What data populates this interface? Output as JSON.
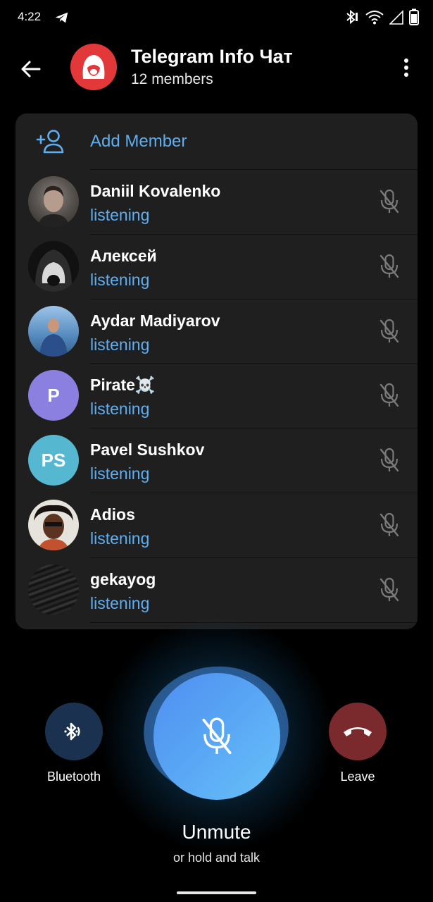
{
  "status_bar": {
    "time": "4:22",
    "icons": [
      "telegram-icon",
      "bluetooth-icon",
      "vibrate-icon",
      "wifi-icon",
      "signal-icon",
      "battery-icon"
    ]
  },
  "header": {
    "title": "Telegram Info Чат",
    "subtitle": "12 members",
    "back_icon": "arrow-left-icon",
    "menu_icon": "more-vertical-icon"
  },
  "participants": {
    "add_member_label": "Add Member",
    "rows": [
      {
        "name": "Daniil Kovalenko",
        "status": "listening",
        "avatar_initials": "",
        "avatar_color": "#5a5a5a"
      },
      {
        "name": "Алексей",
        "status": "listening",
        "avatar_initials": "",
        "avatar_color": "#1a1a1a"
      },
      {
        "name": "Aydar Madiyarov",
        "status": "listening",
        "avatar_initials": "",
        "avatar_color": "#4d86c5"
      },
      {
        "name": "Pirate☠️",
        "status": "listening",
        "avatar_initials": "P",
        "avatar_color": "#8b7fe0"
      },
      {
        "name": "Pavel Sushkov",
        "status": "listening",
        "avatar_initials": "PS",
        "avatar_color": "#55b8d0"
      },
      {
        "name": "Adios",
        "status": "listening",
        "avatar_initials": "",
        "avatar_color": "#8a4a2a"
      },
      {
        "name": "gekayog",
        "status": "listening",
        "avatar_initials": "",
        "avatar_color": "#1b1b1b"
      }
    ]
  },
  "controls": {
    "bluetooth_label": "Bluetooth",
    "leave_label": "Leave",
    "unmute_label": "Unmute",
    "hold_label": "or hold and talk"
  },
  "colors": {
    "accent": "#5eaef1",
    "card_bg": "#1f1f1f",
    "leave": "#7a2a2c",
    "bluetooth": "#1a3150"
  }
}
